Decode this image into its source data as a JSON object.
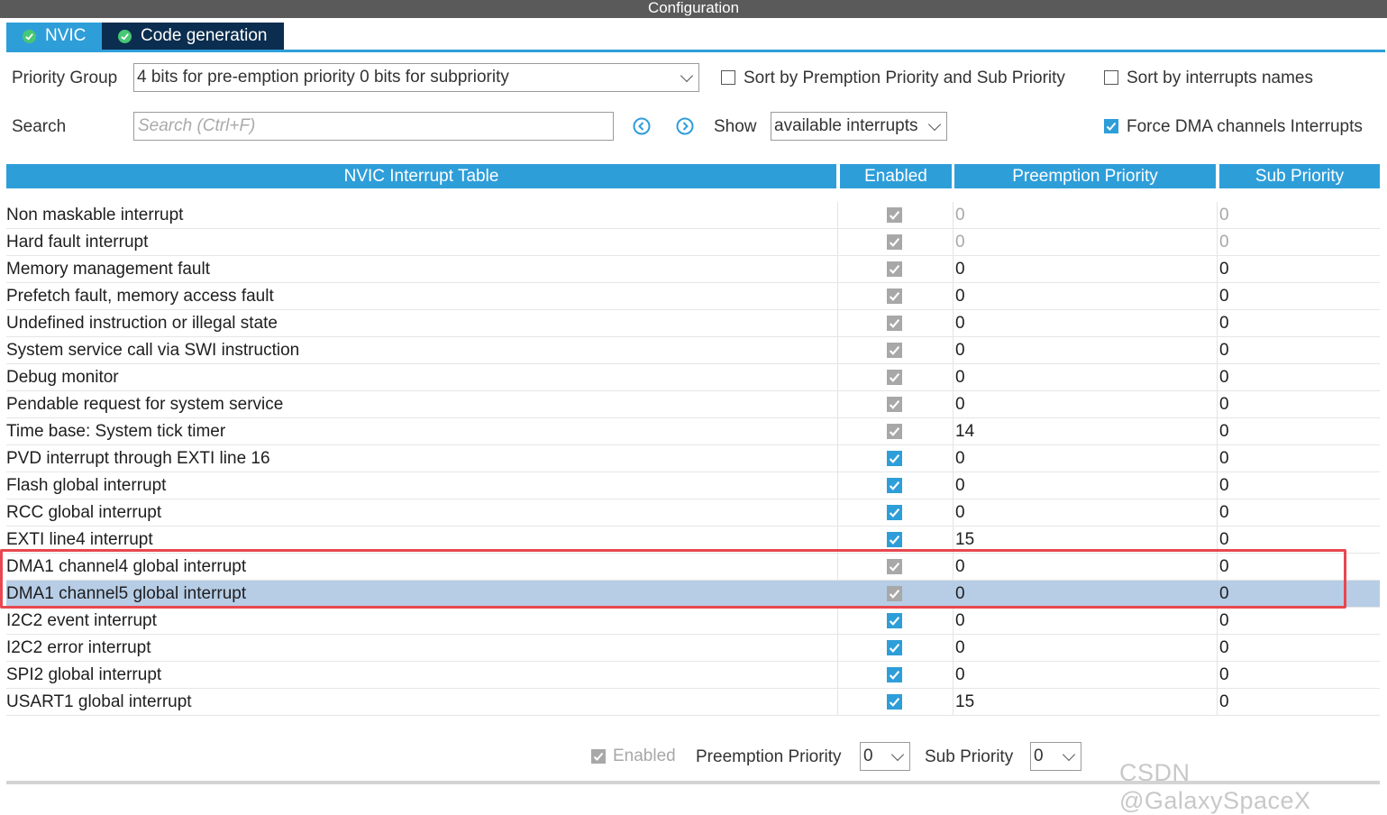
{
  "window": {
    "title": "Configuration"
  },
  "tabs": [
    {
      "label": "NVIC",
      "icon": "check-circle-icon"
    },
    {
      "label": "Code generation",
      "icon": "check-circle-icon"
    }
  ],
  "toolbar": {
    "priority_group_label": "Priority Group",
    "priority_group_value": "4 bits for pre-emption priority 0 bits for subpriority",
    "sort_premption_label": "Sort by Premption Priority and Sub Priority",
    "sort_premption_checked": false,
    "sort_names_label": "Sort by interrupts names",
    "sort_names_checked": false,
    "search_label": "Search",
    "search_placeholder": "Search (Ctrl+F)",
    "search_value": "",
    "prev_icon": "arrow-left-circle-icon",
    "next_icon": "arrow-right-circle-icon",
    "show_label": "Show",
    "show_value": "available interrupts",
    "force_dma_label": "Force DMA channels Interrupts",
    "force_dma_checked": true
  },
  "table": {
    "headers": [
      "NVIC Interrupt Table",
      "Enabled",
      "Preemption Priority",
      "Sub Priority"
    ],
    "rows": [
      {
        "name": "Non maskable interrupt",
        "enabled": true,
        "editable": false,
        "preemption": "0",
        "sub": "0",
        "muted": true
      },
      {
        "name": "Hard fault interrupt",
        "enabled": true,
        "editable": false,
        "preemption": "0",
        "sub": "0",
        "muted": true
      },
      {
        "name": "Memory management fault",
        "enabled": true,
        "editable": false,
        "preemption": "0",
        "sub": "0"
      },
      {
        "name": "Prefetch fault, memory access fault",
        "enabled": true,
        "editable": false,
        "preemption": "0",
        "sub": "0"
      },
      {
        "name": "Undefined instruction or illegal state",
        "enabled": true,
        "editable": false,
        "preemption": "0",
        "sub": "0"
      },
      {
        "name": "System service call via SWI instruction",
        "enabled": true,
        "editable": false,
        "preemption": "0",
        "sub": "0"
      },
      {
        "name": "Debug monitor",
        "enabled": true,
        "editable": false,
        "preemption": "0",
        "sub": "0"
      },
      {
        "name": "Pendable request for system service",
        "enabled": true,
        "editable": false,
        "preemption": "0",
        "sub": "0"
      },
      {
        "name": "Time base: System tick timer",
        "enabled": true,
        "editable": false,
        "preemption": "14",
        "sub": "0"
      },
      {
        "name": "PVD interrupt through EXTI line 16",
        "enabled": true,
        "editable": true,
        "preemption": "0",
        "sub": "0"
      },
      {
        "name": "Flash global interrupt",
        "enabled": true,
        "editable": true,
        "preemption": "0",
        "sub": "0"
      },
      {
        "name": "RCC global interrupt",
        "enabled": true,
        "editable": true,
        "preemption": "0",
        "sub": "0"
      },
      {
        "name": "EXTI line4 interrupt",
        "enabled": true,
        "editable": true,
        "preemption": "15",
        "sub": "0"
      },
      {
        "name": "DMA1 channel4 global interrupt",
        "enabled": true,
        "editable": false,
        "preemption": "0",
        "sub": "0"
      },
      {
        "name": "DMA1 channel5 global interrupt",
        "enabled": true,
        "editable": false,
        "preemption": "0",
        "sub": "0",
        "selected": true
      },
      {
        "name": "I2C2 event interrupt",
        "enabled": true,
        "editable": true,
        "preemption": "0",
        "sub": "0"
      },
      {
        "name": "I2C2 error interrupt",
        "enabled": true,
        "editable": true,
        "preemption": "0",
        "sub": "0"
      },
      {
        "name": "SPI2 global interrupt",
        "enabled": true,
        "editable": true,
        "preemption": "0",
        "sub": "0"
      },
      {
        "name": "USART1 global interrupt",
        "enabled": true,
        "editable": true,
        "preemption": "15",
        "sub": "0"
      }
    ]
  },
  "footer": {
    "enabled_label": "Enabled",
    "enabled_checked": true,
    "preemption_label": "Preemption Priority",
    "preemption_value": "0",
    "sub_label": "Sub Priority",
    "sub_value": "0"
  },
  "watermark": "CSDN @GalaxySpaceX",
  "colors": {
    "accent": "#2e9ed9",
    "tab_active_dark": "#0b2d4f",
    "selection": "#b7cde6",
    "highlight_box": "#e8474f"
  }
}
